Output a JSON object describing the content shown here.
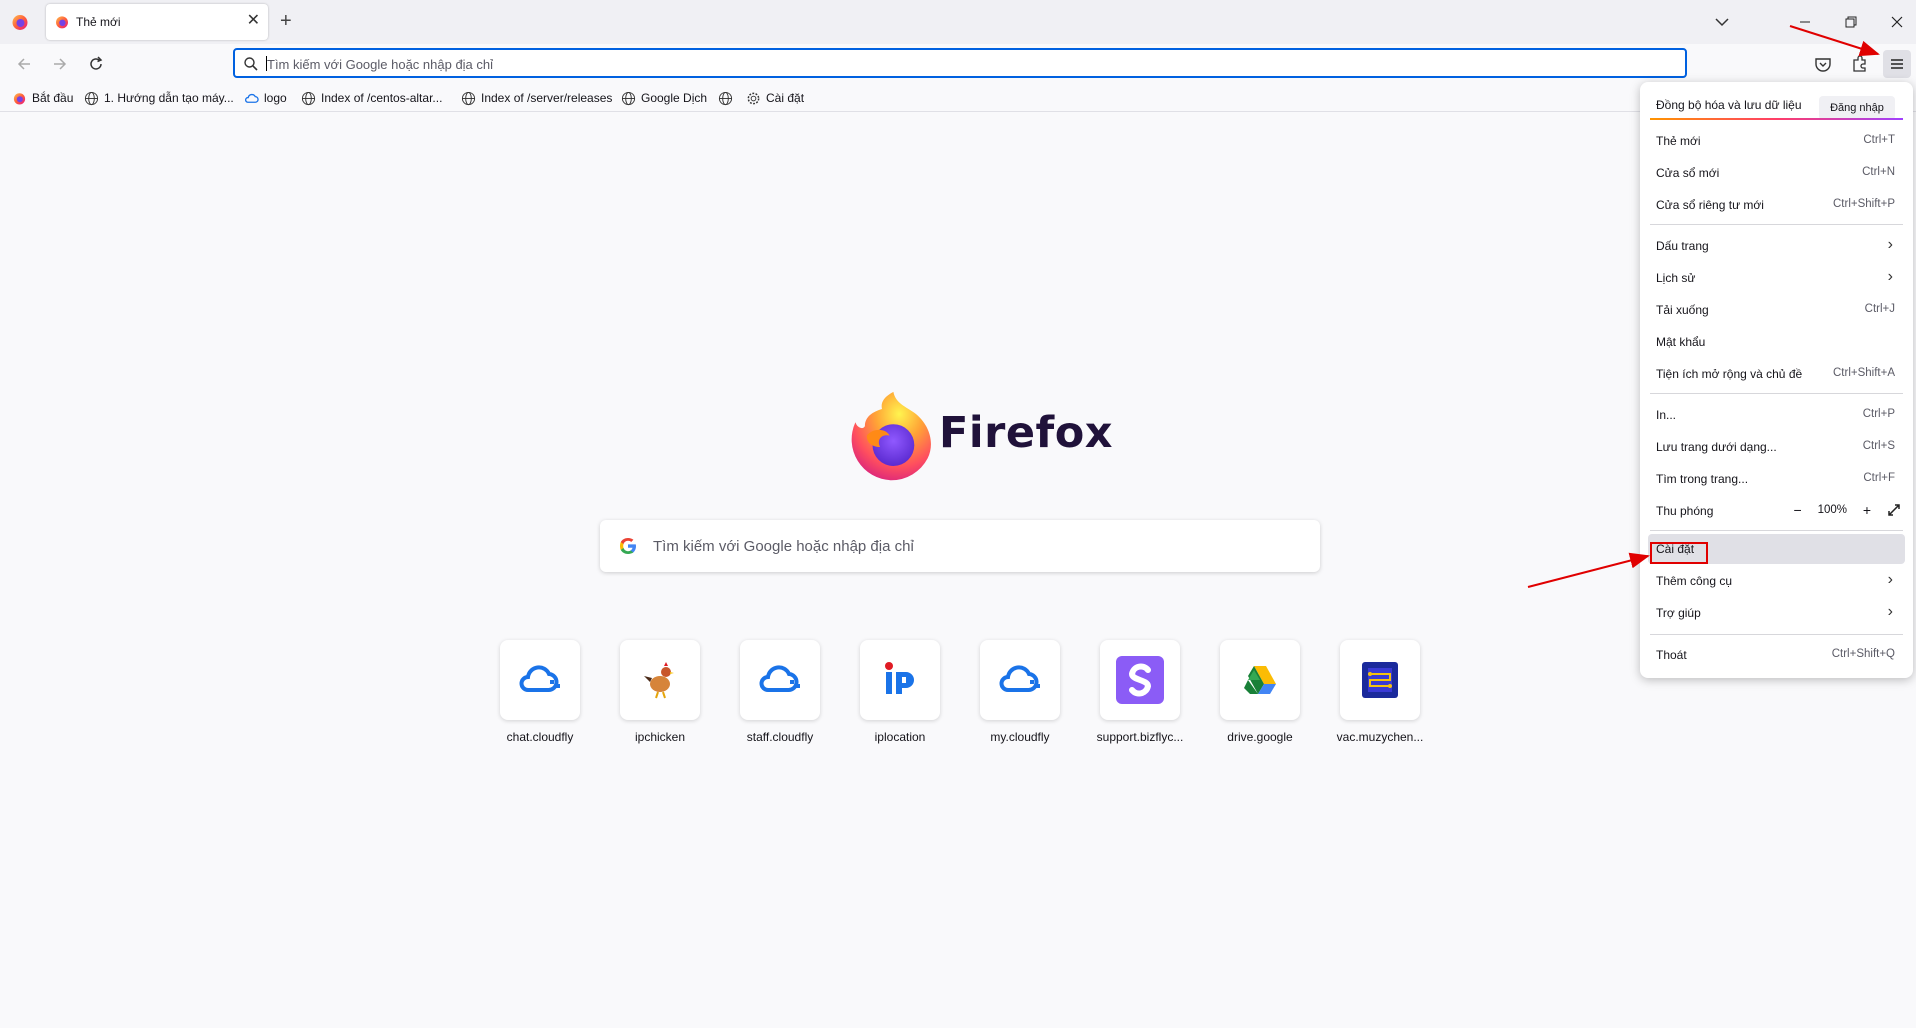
{
  "browser": {
    "tab": {
      "title": "Thẻ mới",
      "close_glyph": "✕"
    },
    "new_tab_glyph": "+",
    "url_bar": {
      "placeholder": "Tìm kiếm với Google hoặc nhập địa chỉ",
      "value": ""
    }
  },
  "bookmarks": [
    {
      "label": "Bắt đầu",
      "icon": "firefox-icon"
    },
    {
      "label": "1. Hướng dẫn tạo máy...",
      "icon": "globe-icon"
    },
    {
      "label": "logo",
      "icon": "cloud-icon"
    },
    {
      "label": "Index of /centos-altar...",
      "icon": "globe-icon"
    },
    {
      "label": "Index of /server/releases",
      "icon": "globe-icon"
    },
    {
      "label": "Google Dịch",
      "icon": "globe-icon"
    },
    {
      "label": "",
      "icon": "globe-icon"
    },
    {
      "label": "Cài đặt",
      "icon": "gear-icon"
    }
  ],
  "home": {
    "brand": "Firefox",
    "search_placeholder": "Tìm kiếm với Google hoặc nhập địa chỉ",
    "top_sites": [
      {
        "label": "chat.cloudfly",
        "icon": "cloudfly-icon"
      },
      {
        "label": "ipchicken",
        "icon": "chicken-icon"
      },
      {
        "label": "staff.cloudfly",
        "icon": "cloudfly-icon"
      },
      {
        "label": "iplocation",
        "icon": "iplocation-icon"
      },
      {
        "label": "my.cloudfly",
        "icon": "cloudfly-icon"
      },
      {
        "label": "support.bizflyc...",
        "icon": "bizfly-icon"
      },
      {
        "label": "drive.google",
        "icon": "google-drive-icon"
      },
      {
        "label": "vac.muzychen...",
        "icon": "vac-icon"
      }
    ]
  },
  "menu": {
    "sync_text": "Đồng bộ hóa và lưu dữ liệu",
    "sign_in": "Đăng nhập",
    "items": {
      "new_tab": {
        "label": "Thẻ mới",
        "shortcut": "Ctrl+T"
      },
      "new_window": {
        "label": "Cửa sổ mới",
        "shortcut": "Ctrl+N"
      },
      "new_private_window": {
        "label": "Cửa sổ riêng tư mới",
        "shortcut": "Ctrl+Shift+P"
      },
      "bookmarks": {
        "label": "Dấu trang"
      },
      "history": {
        "label": "Lịch sử"
      },
      "downloads": {
        "label": "Tải xuống",
        "shortcut": "Ctrl+J"
      },
      "passwords": {
        "label": "Mật khẩu"
      },
      "addons": {
        "label": "Tiện ích mở rộng và chủ đề",
        "shortcut": "Ctrl+Shift+A"
      },
      "print": {
        "label": "In...",
        "shortcut": "Ctrl+P"
      },
      "save_page": {
        "label": "Lưu trang dưới dạng...",
        "shortcut": "Ctrl+S"
      },
      "find": {
        "label": "Tìm trong trang...",
        "shortcut": "Ctrl+F"
      },
      "zoom": {
        "label": "Thu phóng",
        "minus": "−",
        "value": "100%",
        "plus": "+"
      },
      "settings": {
        "label": "Cài đặt"
      },
      "more_tools": {
        "label": "Thêm công cụ"
      },
      "help": {
        "label": "Trợ giúp"
      },
      "quit": {
        "label": "Thoát",
        "shortcut": "Ctrl+Shift+Q"
      }
    },
    "chevron": "›"
  },
  "colors": {
    "accent": "#0061e0",
    "annotation": "#e00000",
    "brand_text": "#20123a"
  }
}
